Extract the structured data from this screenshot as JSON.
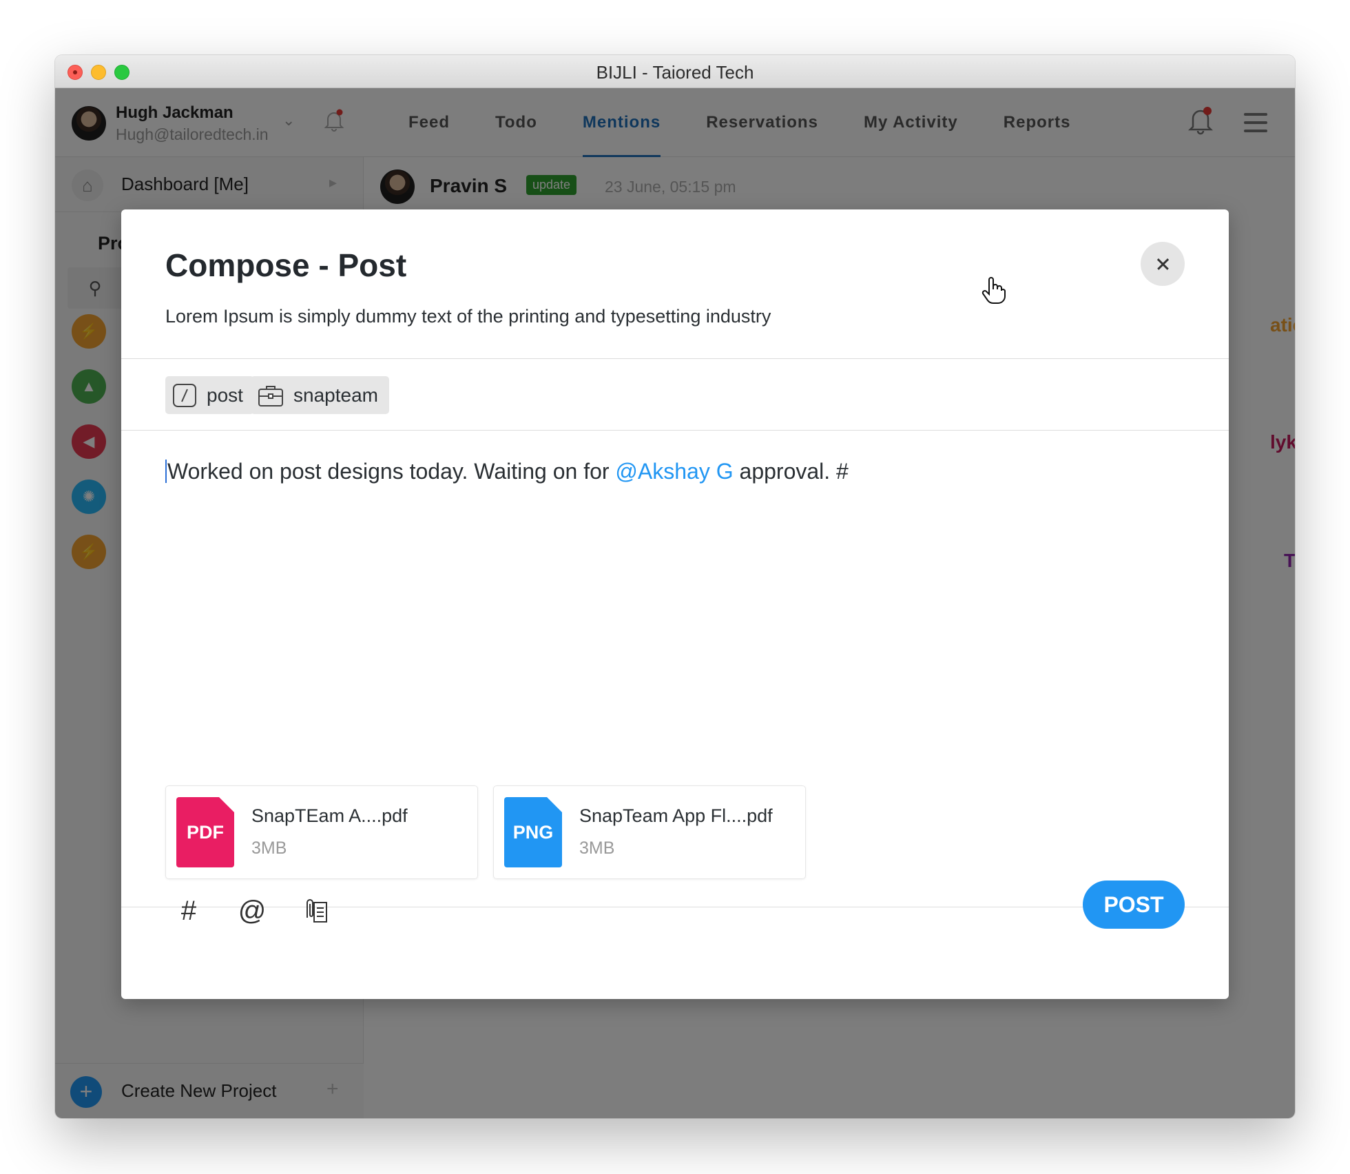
{
  "window": {
    "title": "BIJLI - Taiored Tech"
  },
  "user": {
    "name": "Hugh Jackman",
    "email": "Hugh@tailoredtech.in"
  },
  "nav": {
    "tabs": [
      {
        "label": "Feed"
      },
      {
        "label": "Todo"
      },
      {
        "label": "Mentions"
      },
      {
        "label": "Reservations"
      },
      {
        "label": "My Activity"
      },
      {
        "label": "Reports"
      }
    ],
    "active_tab": "Mentions"
  },
  "sidebar": {
    "dashboard_label": "Dashboard [Me]",
    "projects_heading": "Pro",
    "create_project_label": "Create New Project"
  },
  "feed": {
    "author": "Pravin S",
    "badge": "update",
    "timestamp": "23 June, 05:15 pm",
    "right_labels": [
      "atics",
      "lykaa",
      "Team"
    ]
  },
  "modal": {
    "title": "Compose - Post",
    "subtitle": "Lorem Ipsum is simply dummy text of the printing and typesetting industry",
    "tags": [
      {
        "label": "post",
        "icon": "slash-icon"
      },
      {
        "label": "snapteam",
        "icon": "briefcase-icon"
      }
    ],
    "body": {
      "before": "Worked on post designs today. Waiting on for ",
      "mention": "@Akshay G",
      "after": " approval. #"
    },
    "attachments": [
      {
        "type": "PDF",
        "name": "SnapTEam A....pdf",
        "size": "3MB",
        "color": "#e91e63"
      },
      {
        "type": "PNG",
        "name": "SnapTeam App Fl....pdf",
        "size": "3MB",
        "color": "#2196f3"
      }
    ],
    "toolbar": {
      "hash": "#",
      "at": "@"
    },
    "post_label": "POST"
  },
  "colors": {
    "accent": "#2196f3",
    "active_tab": "#1e6fb8",
    "badge": "#2e9e2e"
  }
}
